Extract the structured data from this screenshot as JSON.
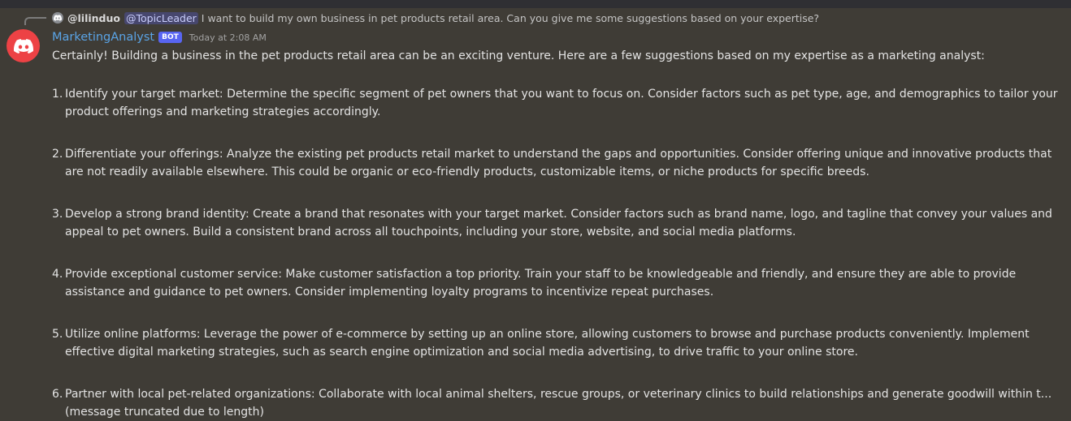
{
  "reply": {
    "author": "@lilinduo",
    "mention": "@TopicLeader",
    "text": "I want to build my own business in pet products retail area. Can you give me some suggestions based on your expertise?"
  },
  "message": {
    "author": "MarketingAnalyst",
    "bot_tag": "BOT",
    "timestamp": "Today at 2:08 AM",
    "intro": "Certainly! Building a business in the pet products retail area can be an exciting venture. Here are a few suggestions based on my expertise as a marketing analyst:",
    "items": [
      {
        "num": "1.",
        "text": "Identify your target market: Determine the specific segment of pet owners that you want to focus on. Consider factors such as pet type, age, and demographics to tailor your product offerings and marketing strategies accordingly."
      },
      {
        "num": "2.",
        "text": "Differentiate your offerings: Analyze the existing pet products retail market to understand the gaps and opportunities. Consider offering unique and innovative products that are not readily available elsewhere. This could be organic or eco-friendly products, customizable items, or niche products for specific breeds."
      },
      {
        "num": "3.",
        "text": "Develop a strong brand identity: Create a brand that resonates with your target market. Consider factors such as brand name, logo, and tagline that convey your values and appeal to pet owners. Build a consistent brand across all touchpoints, including your store, website, and social media platforms."
      },
      {
        "num": "4.",
        "text": "Provide exceptional customer service: Make customer satisfaction a top priority. Train your staff to be knowledgeable and friendly, and ensure they are able to provide assistance and guidance to pet owners. Consider implementing loyalty programs to incentivize repeat purchases."
      },
      {
        "num": "5.",
        "text": "Utilize online platforms: Leverage the power of e-commerce by setting up an online store, allowing customers to browse and purchase products conveniently. Implement effective digital marketing strategies, such as search engine optimization and social media advertising, to drive traffic to your online store."
      },
      {
        "num": "6.",
        "text": "Partner with local pet-related organizations: Collaborate with local animal shelters, rescue groups, or veterinary clinics to build relationships and generate goodwill within t... (message truncated due to length)"
      }
    ]
  },
  "colors": {
    "background": "#3f3c36",
    "author": "#5aa4e6",
    "bot_tag": "#5865f2",
    "avatar": "#ed4245"
  },
  "icons": {
    "reply_avatar": "discord-icon",
    "bot_avatar": "discord-icon"
  }
}
